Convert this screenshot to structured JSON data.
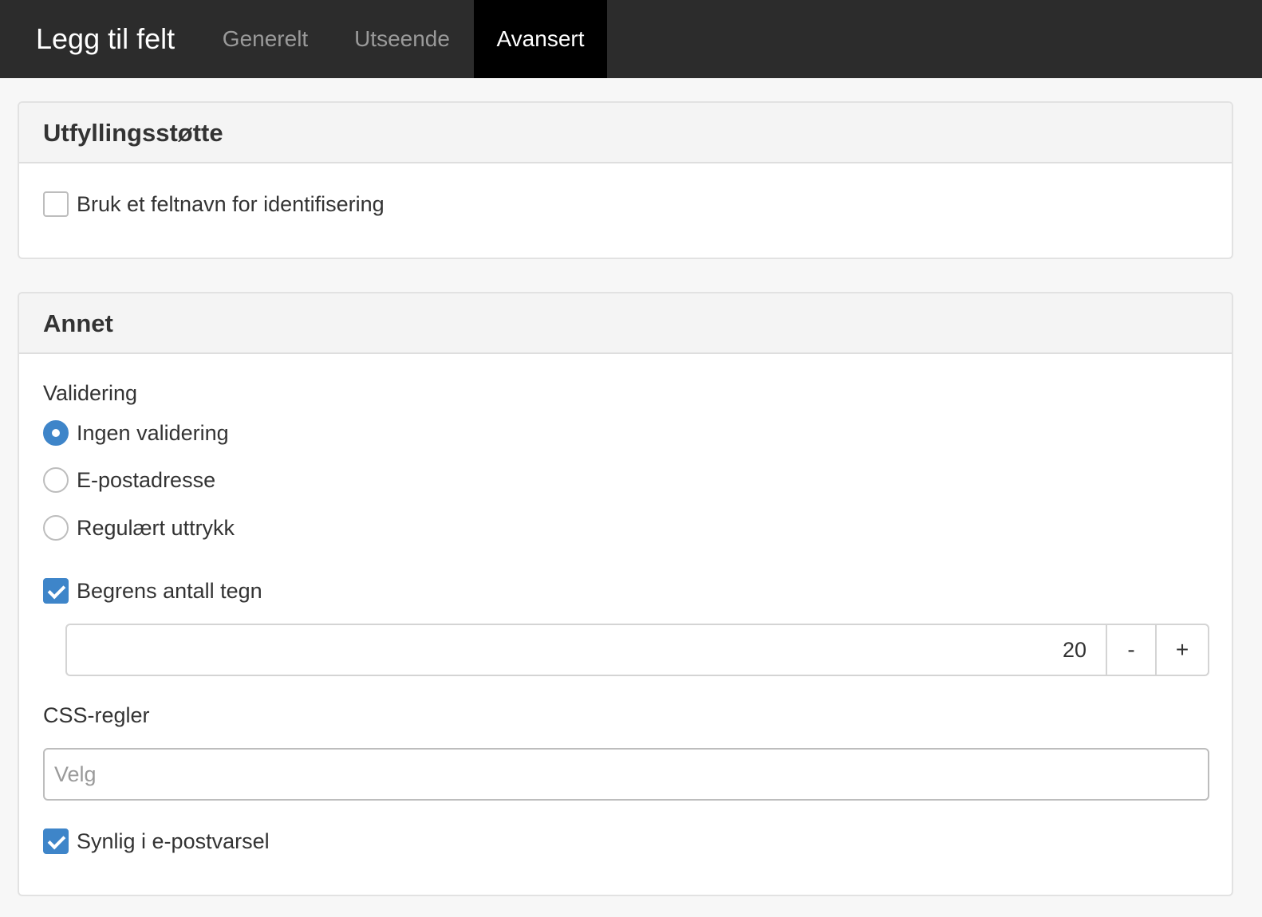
{
  "header": {
    "title": "Legg til felt",
    "tabs": [
      {
        "label": "Generelt",
        "active": false
      },
      {
        "label": "Utseende",
        "active": false
      },
      {
        "label": "Avansert",
        "active": true
      }
    ]
  },
  "colors": {
    "accent": "#3e85c9",
    "topbar_bg": "#2c2c2c",
    "active_tab_bg": "#000000"
  },
  "autofill_panel": {
    "title": "Utfyllingsstøtte",
    "use_fieldname_label": "Bruk et feltnavn for identifisering",
    "use_fieldname_checked": false
  },
  "other_panel": {
    "title": "Annet",
    "validation": {
      "label": "Validering",
      "options": [
        {
          "label": "Ingen validering",
          "selected": true
        },
        {
          "label": "E-postadresse",
          "selected": false
        },
        {
          "label": "Regulært uttrykk",
          "selected": false
        }
      ]
    },
    "limit_chars": {
      "label": "Begrens antall tegn",
      "checked": true,
      "value": "20",
      "decrement_label": "-",
      "increment_label": "+"
    },
    "css_rules": {
      "label": "CSS-regler",
      "placeholder": "Velg"
    },
    "visible_in_email": {
      "label": "Synlig i e-postvarsel",
      "checked": true
    }
  }
}
